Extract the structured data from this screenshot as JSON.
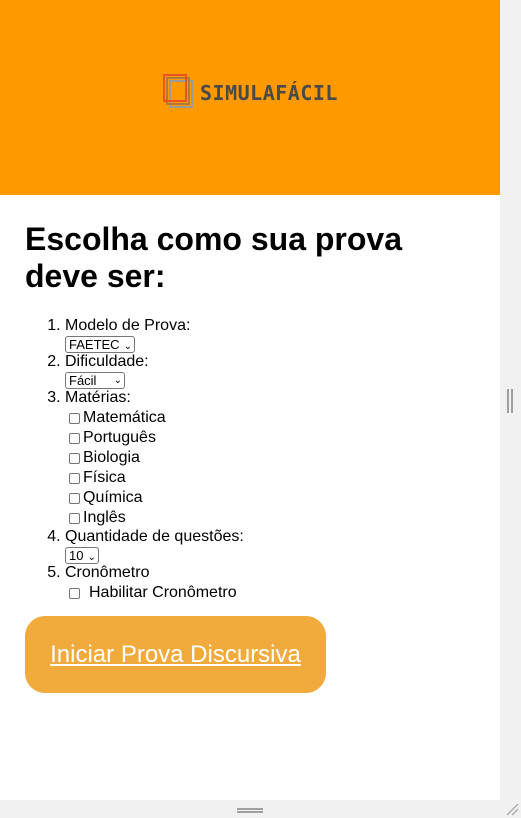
{
  "header": {
    "brand_text": "SIMULAFÁCIL",
    "background": "#ff9900"
  },
  "form": {
    "title": "Escolha como sua prova deve ser:",
    "model_label": "Modelo de Prova:",
    "model_value": "FAETEC",
    "difficulty_label": "Dificuldade:",
    "difficulty_value": "Fácil",
    "subjects_label": "Matérias:",
    "subjects": [
      "Matemática",
      "Português",
      "Biologia",
      "Física",
      "Química",
      "Inglês"
    ],
    "quantity_label": "Quantidade de questões:",
    "quantity_value": "10",
    "timer_label": "Cronômetro",
    "timer_option": "Habilitar Cronômetro",
    "start_button": "Iniciar Prova Discursiva",
    "button_color": "#f0ab3c"
  }
}
